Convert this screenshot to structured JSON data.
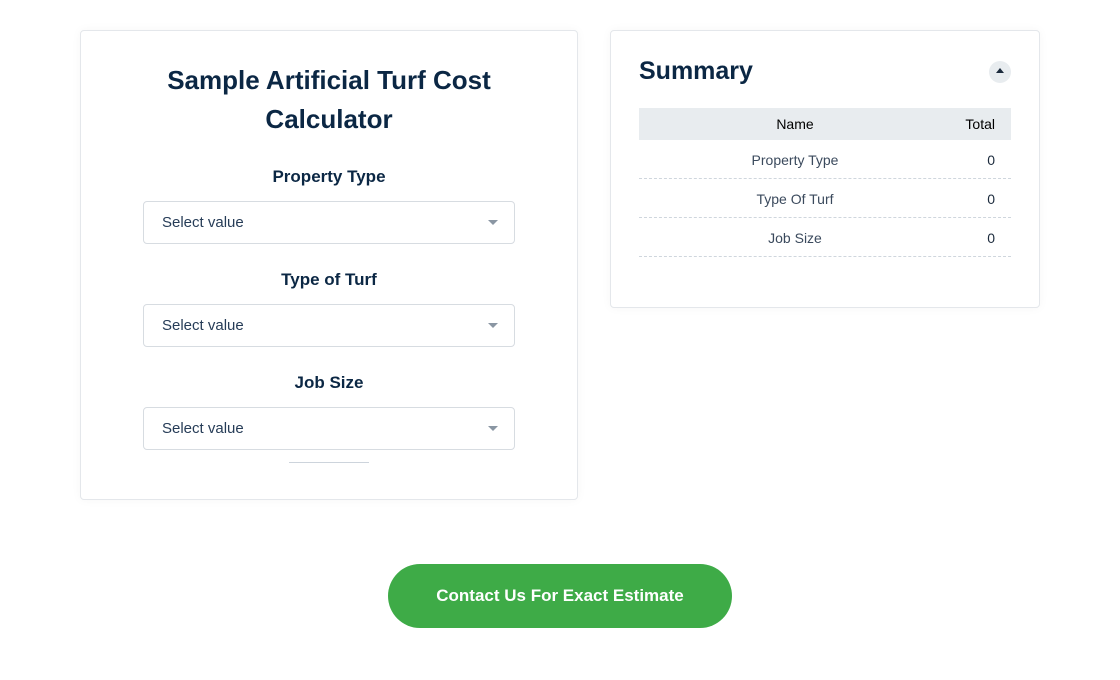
{
  "calculator": {
    "title": "Sample Artificial Turf Cost Calculator",
    "fields": {
      "property_type": {
        "label": "Property Type",
        "placeholder": "Select value"
      },
      "turf_type": {
        "label": "Type of Turf",
        "placeholder": "Select value"
      },
      "job_size": {
        "label": "Job Size",
        "placeholder": "Select value"
      }
    }
  },
  "summary": {
    "title": "Summary",
    "columns": {
      "name": "Name",
      "total": "Total"
    },
    "rows": [
      {
        "name": "Property Type",
        "total": "0"
      },
      {
        "name": "Type Of Turf",
        "total": "0"
      },
      {
        "name": "Job Size",
        "total": "0"
      }
    ]
  },
  "cta": {
    "label": "Contact Us For Exact Estimate"
  }
}
